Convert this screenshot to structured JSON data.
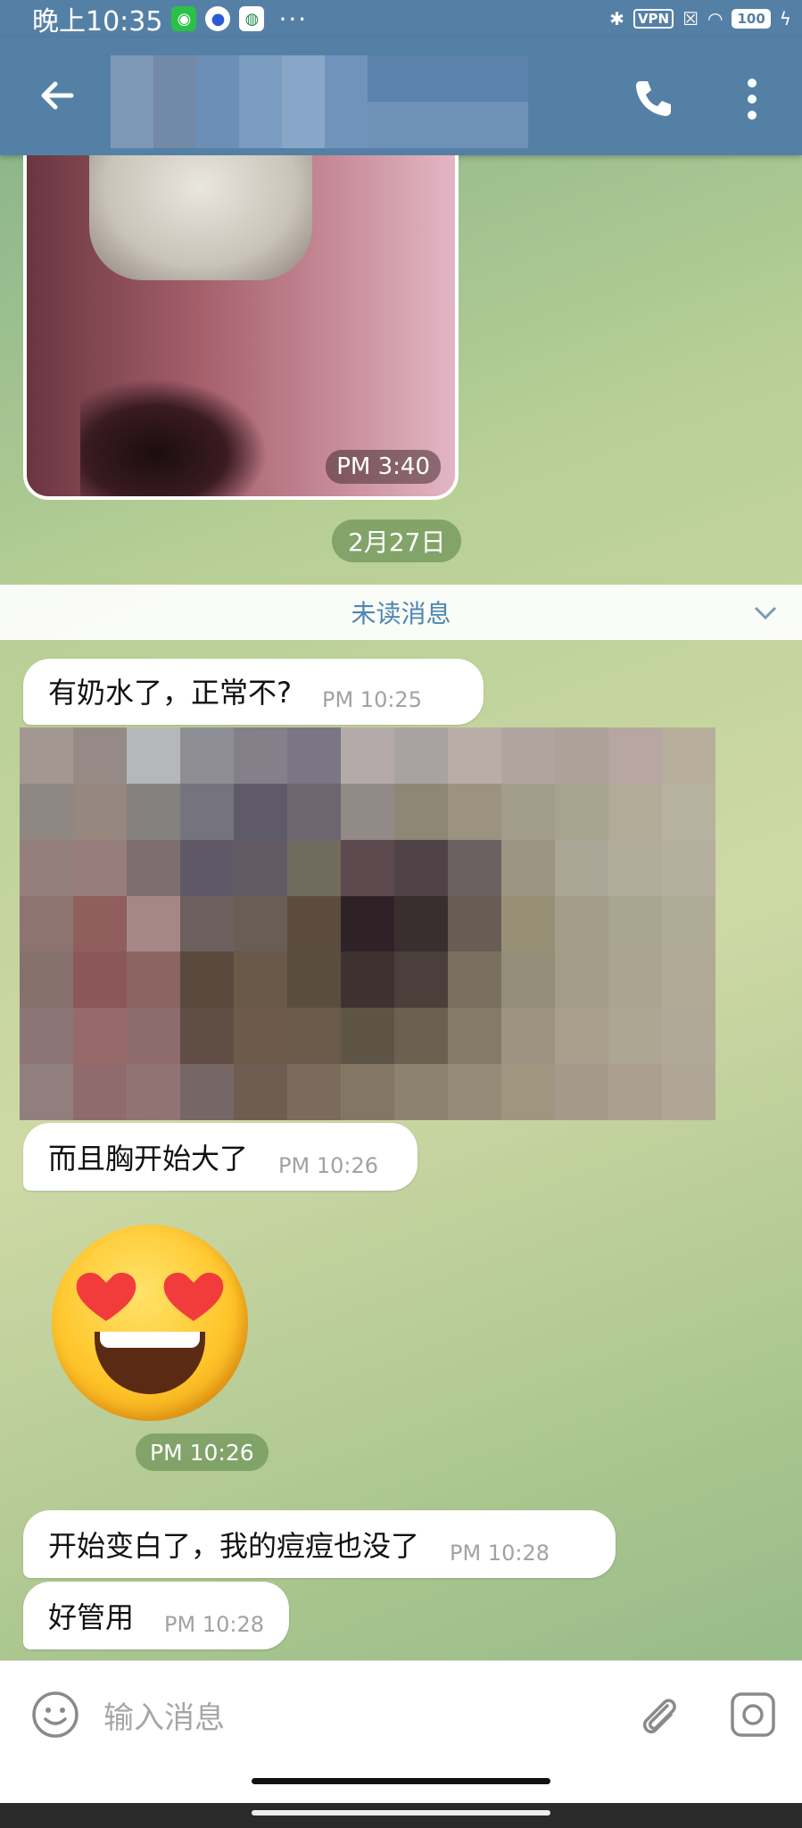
{
  "status_bar": {
    "time": "晚上10:35",
    "vpn_label": "VPN",
    "battery": "100"
  },
  "chat": {
    "photo_time": "PM 3:40",
    "date_divider": "2月27日",
    "unread_label": "未读消息",
    "messages": [
      {
        "text": "有奶水了，正常不?",
        "time": "PM 10:25"
      },
      {
        "text": "而且胸开始大了",
        "time": "PM 10:26"
      },
      {
        "text": "开始变白了，我的痘痘也没了",
        "time": "PM 10:28"
      },
      {
        "text": "好管用",
        "time": "PM 10:28"
      }
    ],
    "emoji_time": "PM 10:26"
  },
  "input": {
    "placeholder": "输入消息"
  },
  "colors": {
    "header": "#5580a6",
    "unread_text": "#4f86b3",
    "chip": "#70965a"
  }
}
